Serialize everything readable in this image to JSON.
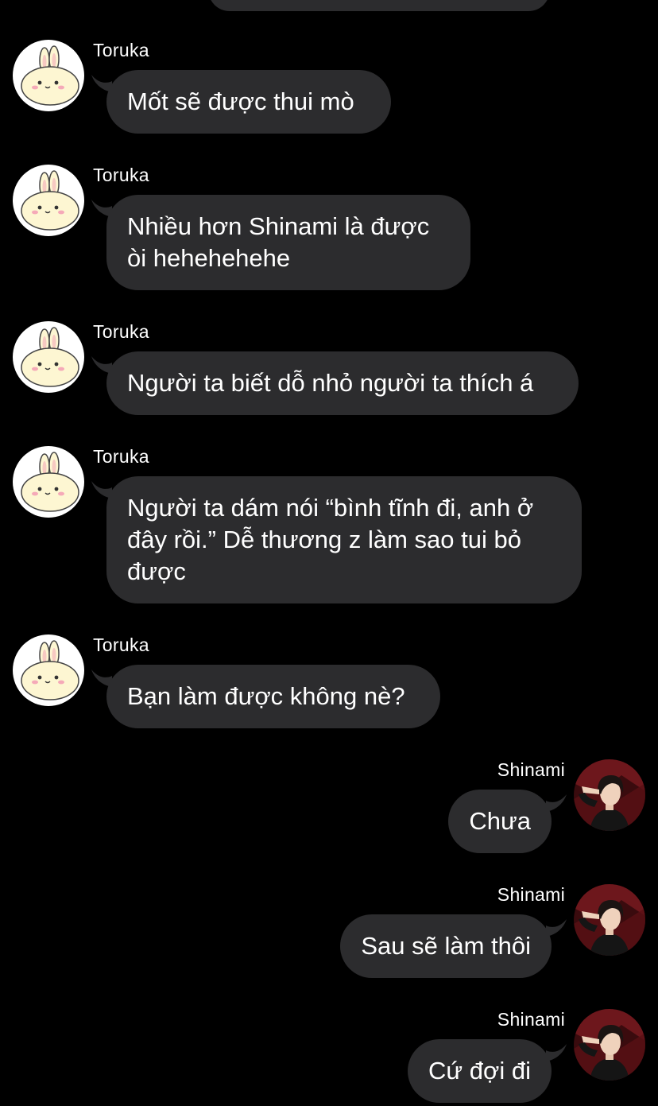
{
  "conversation": {
    "messages": [
      {
        "sender": "Toruka",
        "text": "Mốt sẽ được thui mò"
      },
      {
        "sender": "Toruka",
        "text": "Nhiều hơn Shinami là được\nòi hehehehehe"
      },
      {
        "sender": "Toruka",
        "text": "Người ta biết dỗ nhỏ người ta thích á"
      },
      {
        "sender": "Toruka",
        "text": "Người ta dám nói “bình tĩnh đi, anh ở\nđây rồi.” Dễ thương z làm sao tui bỏ\nđược"
      },
      {
        "sender": "Toruka",
        "text": "Bạn làm được không nè?"
      },
      {
        "sender": "Shinami",
        "text": "Chưa"
      },
      {
        "sender": "Shinami",
        "text": "Sau sẽ làm thôi"
      },
      {
        "sender": "Shinami",
        "text": "Cứ đợi đi"
      }
    ]
  },
  "colors": {
    "background": "#000000",
    "bubble": "#2c2c2e",
    "text": "#ffffff"
  },
  "icons": {
    "toruka_avatar": "bunny-avatar-icon",
    "shinami_avatar": "person-photo-avatar-icon"
  }
}
